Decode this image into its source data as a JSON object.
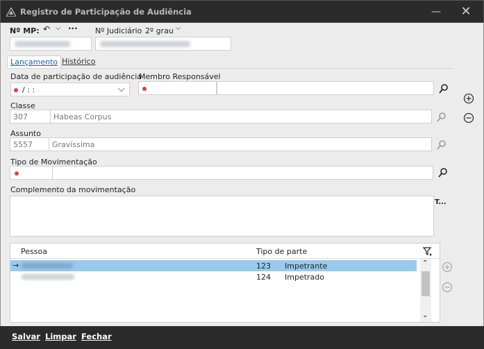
{
  "window": {
    "title": "Registro de Participação de Audiência"
  },
  "header": {
    "mp_label": "Nº MP:",
    "judiciario_label": "Nº Judiciário",
    "grau": "2º grau"
  },
  "tabs": [
    {
      "label": "Lançamento"
    },
    {
      "label": "Histórico"
    }
  ],
  "form": {
    "data_label": "Data de participação de audiência",
    "data_value": "/      : :",
    "membro_label": "Membro Responsável",
    "classe_label": "Classe",
    "classe_code": "307",
    "classe_name": "Habeas Corpus",
    "assunto_label": "Assunto",
    "assunto_code": "5557",
    "assunto_name": "Gravíssima",
    "tipo_label": "Tipo de Movimentação",
    "complemento_label": "Complemento da movimentação",
    "complemento_tool": "T..."
  },
  "grid": {
    "col_pessoa": "Pessoa",
    "col_tipo": "Tipo de parte",
    "rows": [
      {
        "code": "123",
        "tipo": "Impetrante"
      },
      {
        "code": "124",
        "tipo": "Impetrado"
      }
    ]
  },
  "footer": {
    "salvar": "Salvar",
    "limpar": "Limpar",
    "fechar": "Fechar"
  },
  "colors": {
    "titlebar": "#2b2b2b",
    "selection": "#99c9ef",
    "required_dot": "#e04040"
  }
}
